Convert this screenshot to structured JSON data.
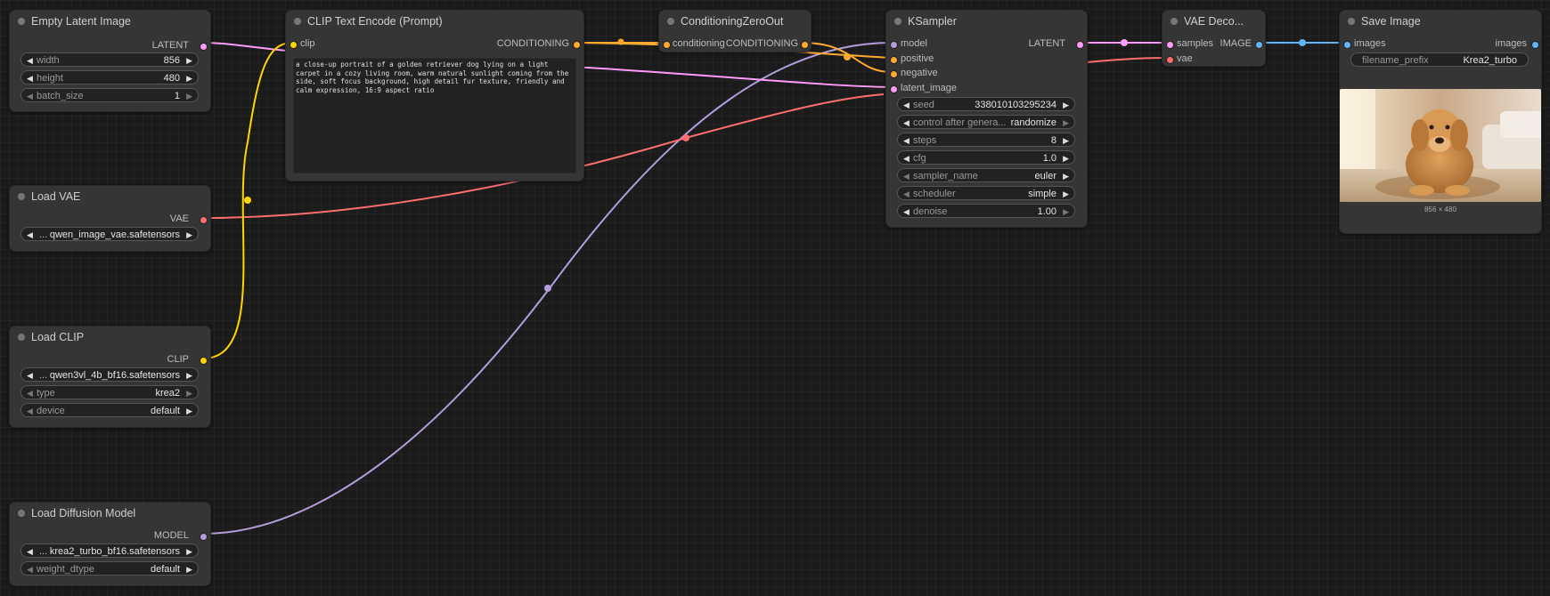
{
  "colors": {
    "latent": "#ff9cf9",
    "clip": "#ffd500",
    "conditioning": "#ffa931",
    "vae": "#ff6e6e",
    "model": "#b39ddb",
    "image": "#64b5f6"
  },
  "nodes": {
    "empty_latent": {
      "title": "Empty Latent Image",
      "output": "LATENT",
      "widgets": [
        {
          "name": "width",
          "value": "856"
        },
        {
          "name": "height",
          "value": "480"
        },
        {
          "name": "batch_size",
          "value": "1"
        }
      ]
    },
    "load_vae": {
      "title": "Load VAE",
      "output": "VAE",
      "widget_value": "qwen_image_vae.safetensors",
      "widget_prefix": "..."
    },
    "load_clip": {
      "title": "Load CLIP",
      "output": "CLIP",
      "widget_value": "qwen3vl_4b_bf16.safetensors",
      "widget_prefix": "...",
      "widgets": [
        {
          "name": "type",
          "value": "krea2"
        },
        {
          "name": "device",
          "value": "default"
        }
      ]
    },
    "load_model": {
      "title": "Load Diffusion Model",
      "output": "MODEL",
      "widget_value": "krea2_turbo_bf16.safetensors",
      "widget_prefix": "...",
      "widgets": [
        {
          "name": "weight_dtype",
          "value": "default"
        }
      ]
    },
    "clip_encode": {
      "title": "CLIP Text Encode (Prompt)",
      "input": "clip",
      "output": "CONDITIONING",
      "text": "a close-up portrait of a golden retriever dog lying on a light\ncarpet in a cozy living room, warm natural sunlight coming from the\nside, soft focus background, high detail fur texture, friendly and\ncalm expression, 16:9 aspect ratio"
    },
    "zero_out": {
      "title": "ConditioningZeroOut",
      "input": "conditioning",
      "output": "CONDITIONING"
    },
    "ksampler": {
      "title": "KSampler",
      "inputs": [
        "model",
        "positive",
        "negative",
        "latent_image"
      ],
      "output": "LATENT",
      "widgets": [
        {
          "name": "seed",
          "value": "338010103295234"
        },
        {
          "name": "control after genera...",
          "value": "randomize"
        },
        {
          "name": "steps",
          "value": "8"
        },
        {
          "name": "cfg",
          "value": "1.0"
        },
        {
          "name": "sampler_name",
          "value": "euler"
        },
        {
          "name": "scheduler",
          "value": "simple"
        },
        {
          "name": "denoise",
          "value": "1.00"
        }
      ]
    },
    "vae_decode": {
      "title": "VAE Deco...",
      "inputs": [
        "samples",
        "vae"
      ],
      "output": "IMAGE"
    },
    "save_image": {
      "title": "Save Image",
      "input": "images",
      "output": "images",
      "widgets": [
        {
          "name": "filename_prefix",
          "value": "Krea2_turbo"
        }
      ],
      "caption": "856 × 480"
    }
  }
}
